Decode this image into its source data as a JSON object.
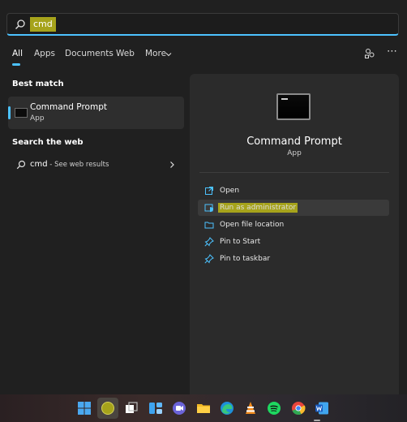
{
  "search": {
    "query": "cmd"
  },
  "tabs": [
    {
      "label": "All",
      "active": true
    },
    {
      "label": "Apps"
    },
    {
      "label": "Documents"
    },
    {
      "label": "Web"
    },
    {
      "label": "More"
    }
  ],
  "left": {
    "best_match_title": "Best match",
    "best_match": {
      "title": "Command Prompt",
      "subtitle": "App"
    },
    "web_title": "Search the web",
    "web_result": {
      "query": "cmd",
      "suffix": " - See web results"
    }
  },
  "detail": {
    "title": "Command Prompt",
    "subtitle": "App",
    "actions": [
      {
        "label": "Open",
        "icon": "open-icon"
      },
      {
        "label": "Run as administrator",
        "icon": "shield-icon",
        "highlighted": true
      },
      {
        "label": "Open file location",
        "icon": "folder-icon"
      },
      {
        "label": "Pin to Start",
        "icon": "pin-icon"
      },
      {
        "label": "Pin to taskbar",
        "icon": "pin-icon"
      }
    ]
  },
  "taskbar": {
    "icons": [
      "start-icon",
      "search-icon",
      "task-view-icon",
      "widgets-icon",
      "teams-chat-icon",
      "file-explorer-icon",
      "edge-icon",
      "vlc-icon",
      "spotify-icon",
      "chrome-icon",
      "word-icon"
    ]
  },
  "colors": {
    "accent": "#4cc2ff",
    "highlight": "#a6a31b",
    "panel": "#202020",
    "detail_panel": "#2b2b2b"
  }
}
